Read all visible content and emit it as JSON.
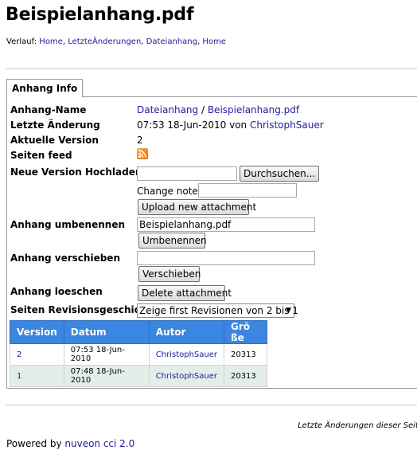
{
  "page": {
    "title": "Beispielanhang.pdf"
  },
  "breadcrumb": {
    "prefix": "Verlauf:",
    "links": [
      "Home",
      "LetzteÄnderungen",
      "Dateianhang",
      "Home"
    ]
  },
  "tab": {
    "label": "Anhang Info"
  },
  "info": {
    "name_label": "Anhang-Name",
    "name_parent": "Dateianhang",
    "name_sep": " / ",
    "name_file": "Beispielanhang.pdf",
    "last_change_label": "Letzte Änderung",
    "last_change_time": "07:53 18-Jun-2010 von ",
    "last_change_user": "ChristophSauer",
    "current_version_label": "Aktuelle Version",
    "current_version": "2",
    "feed_label": "Seiten feed",
    "feed_icon": "rss-icon"
  },
  "upload": {
    "label": "Neue Version Hochladen",
    "file_value": "",
    "browse_label": "Durchsuchen...",
    "note_label": "Change note:",
    "note_value": "",
    "submit_label": "Upload new attachment"
  },
  "rename": {
    "label": "Anhang umbenennen",
    "value": "Beispielanhang.pdf",
    "button_label": "Umbenennen"
  },
  "move": {
    "label": "Anhang verschieben",
    "value": "",
    "button_label": "Verschieben"
  },
  "delete": {
    "label": "Anhang loeschen",
    "button_label": "Delete attachment"
  },
  "history": {
    "label": "Seiten Revisionsgeschichte",
    "select_value": "Zeige first Revisionen von 2 bis 1",
    "columns": [
      "Version",
      "Datum",
      "Autor",
      "Grö ße"
    ],
    "rows": [
      {
        "version": "2",
        "date": "07:53 18-Jun-2010",
        "author": "ChristophSauer",
        "size": "20313"
      },
      {
        "version": "1",
        "date": "07:48 18-Jun-2010",
        "author": "ChristophSauer",
        "size": "20313"
      }
    ]
  },
  "footer": {
    "changes_text": "Letzte Änderungen dieser Seite",
    "powered_prefix": "Powered by ",
    "powered_link": "nuveon cci 2.0"
  },
  "colors": {
    "link": "#1c1c9e",
    "table_header": "#3b86e0",
    "table_alt_row": "#e3eee9"
  }
}
